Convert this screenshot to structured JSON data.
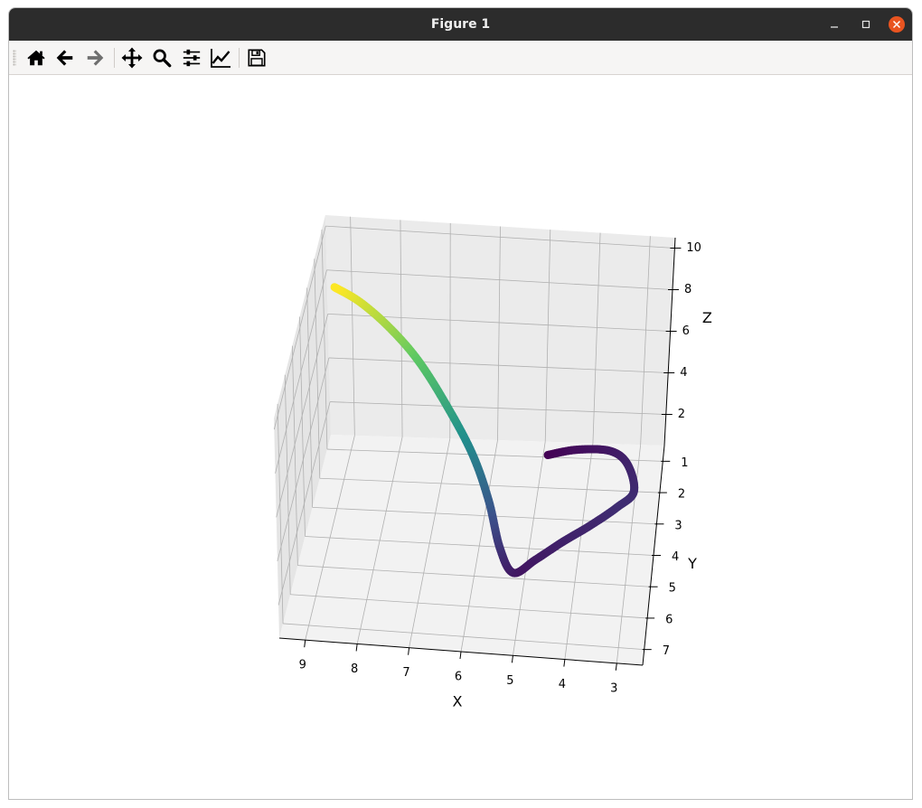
{
  "window": {
    "title": "Figure 1",
    "controls": {
      "minimize": "minimize",
      "maximize": "maximize",
      "close": "close"
    }
  },
  "toolbar": {
    "buttons": [
      {
        "name": "home",
        "icon": "home-icon"
      },
      {
        "name": "back",
        "icon": "arrow-left-icon"
      },
      {
        "name": "forward",
        "icon": "arrow-right-icon"
      },
      {
        "name": "pan",
        "icon": "move-icon"
      },
      {
        "name": "zoom",
        "icon": "magnifier-icon"
      },
      {
        "name": "configure-subplots",
        "icon": "sliders-icon"
      },
      {
        "name": "edit-axes",
        "icon": "line-chart-icon"
      },
      {
        "name": "save",
        "icon": "floppy-disk-icon"
      }
    ]
  },
  "chart_data": {
    "type": "line",
    "title": "",
    "xlabel": "X",
    "ylabel": "Y",
    "zlabel": "Z",
    "x_ticks": [
      "9",
      "8",
      "7",
      "6",
      "5",
      "4",
      "3"
    ],
    "y_ticks": [
      "1",
      "2",
      "3",
      "4",
      "5",
      "6",
      "7"
    ],
    "z_ticks": [
      "2",
      "4",
      "6",
      "8",
      "10"
    ],
    "xlim": [
      2.5,
      9.5
    ],
    "ylim": [
      0.5,
      7.5
    ],
    "zlim": [
      0.5,
      10.5
    ],
    "grid": true,
    "colormap": [
      "#440154",
      "#3b528b",
      "#21918c",
      "#5ec962",
      "#fde725"
    ],
    "series": [
      {
        "x": [
          4.9,
          4.3,
          3.6,
          3.2,
          3.0,
          3.3,
          3.8,
          4.3,
          4.8,
          5.2,
          5.5,
          5.8,
          6.2,
          6.8,
          7.4,
          8.0,
          8.6,
          9.1
        ],
        "y": [
          1.0,
          1.0,
          1.2,
          1.8,
          2.8,
          3.4,
          3.9,
          4.4,
          4.9,
          5.3,
          5.0,
          4.3,
          3.7,
          3.1,
          2.6,
          2.3,
          2.1,
          2.1
        ],
        "z": [
          0.6,
          0.9,
          1.2,
          1.5,
          1.7,
          1.8,
          1.6,
          1.5,
          1.3,
          1.2,
          1.9,
          3.1,
          4.4,
          5.8,
          7.0,
          8.0,
          8.8,
          9.4
        ]
      }
    ]
  }
}
